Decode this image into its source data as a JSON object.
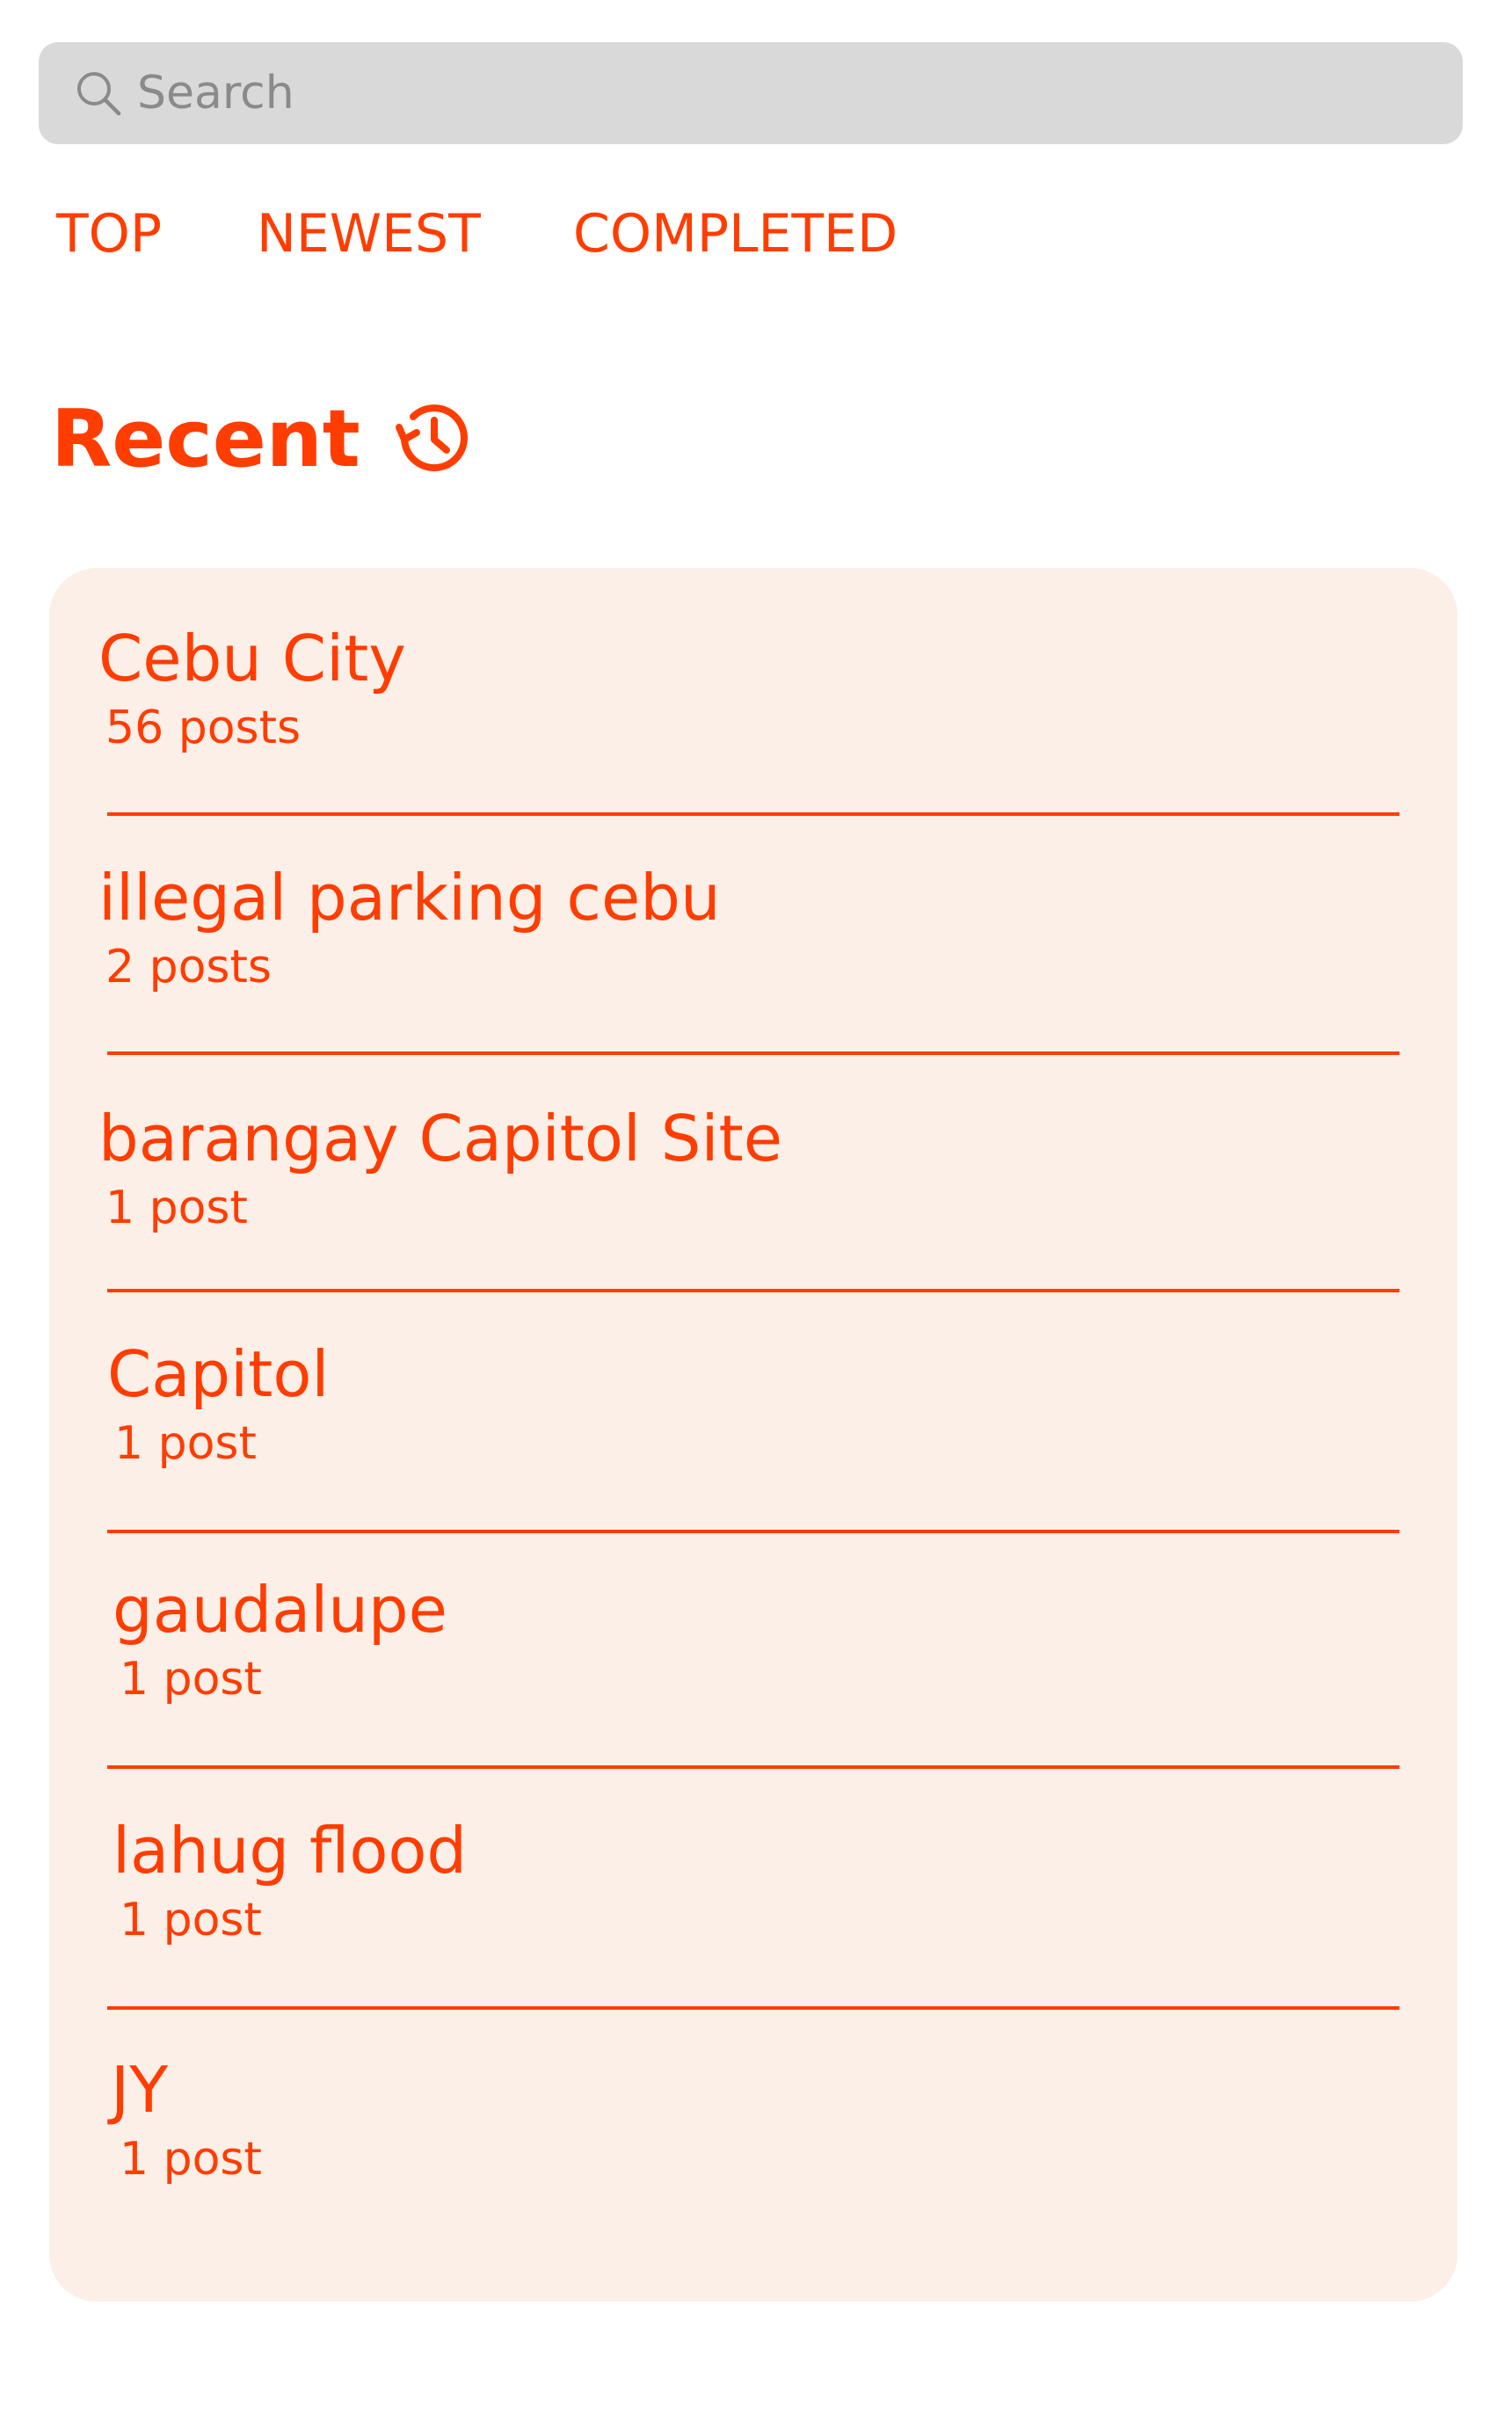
{
  "colors": {
    "accent": "#ff3d00",
    "card_background": "#fcefe7",
    "search_background": "#d9d9d9",
    "placeholder": "#8a8a8a"
  },
  "search": {
    "placeholder": "Search",
    "value": "",
    "icon": "search-icon"
  },
  "tabs": [
    {
      "label": "TOP"
    },
    {
      "label": "NEWEST"
    },
    {
      "label": "COMPLETED"
    }
  ],
  "recent": {
    "title": "Recent",
    "icon": "history-icon",
    "items": [
      {
        "title": "Cebu City",
        "count": "56 posts"
      },
      {
        "title": "illegal parking cebu",
        "count": "2 posts"
      },
      {
        "title": "barangay Capitol Site",
        "count": "1 post"
      },
      {
        "title": "Capitol",
        "count": "1 post"
      },
      {
        "title": "gaudalupe",
        "count": "1 post"
      },
      {
        "title": "lahug flood",
        "count": "1 post"
      },
      {
        "title": "JY",
        "count": "1 post"
      }
    ]
  }
}
